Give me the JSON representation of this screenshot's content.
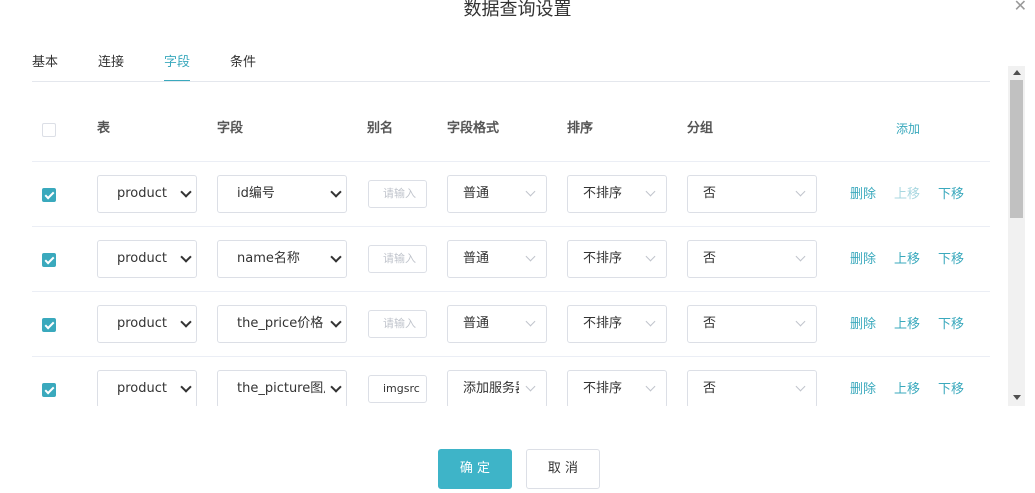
{
  "dialog": {
    "title": "数据查询设置",
    "close_icon": "close-icon"
  },
  "tabs": [
    {
      "label": "基本",
      "active": false
    },
    {
      "label": "连接",
      "active": false
    },
    {
      "label": "字段",
      "active": true
    },
    {
      "label": "条件",
      "active": false
    }
  ],
  "table": {
    "headers": {
      "table": "表",
      "field": "字段",
      "alias": "别名",
      "format": "字段格式",
      "sort": "排序",
      "group": "分组",
      "add": "添加"
    },
    "rows": [
      {
        "checked": true,
        "table": "product",
        "field": "id编号",
        "alias": "",
        "alias_placeholder": "请输入",
        "format": "普通",
        "sort": "不排序",
        "group": "否",
        "delete": "删除",
        "up": "上移",
        "down": "下移",
        "up_enabled": false,
        "down_enabled": true
      },
      {
        "checked": true,
        "table": "product",
        "field": "name名称",
        "alias": "",
        "alias_placeholder": "请输入",
        "format": "普通",
        "sort": "不排序",
        "group": "否",
        "delete": "删除",
        "up": "上移",
        "down": "下移",
        "up_enabled": true,
        "down_enabled": true
      },
      {
        "checked": true,
        "table": "product",
        "field": "the_price价格",
        "alias": "",
        "alias_placeholder": "请输入",
        "format": "普通",
        "sort": "不排序",
        "group": "否",
        "delete": "删除",
        "up": "上移",
        "down": "下移",
        "up_enabled": true,
        "down_enabled": true
      },
      {
        "checked": true,
        "table": "product",
        "field": "the_picture图片",
        "alias": "imgsrc",
        "alias_placeholder": "请输入",
        "format": "添加服务器地址",
        "sort": "不排序",
        "group": "否",
        "delete": "删除",
        "up": "上移",
        "down": "下移",
        "up_enabled": true,
        "down_enabled": true
      }
    ]
  },
  "footer": {
    "confirm": "确 定",
    "cancel": "取 消"
  },
  "colors": {
    "accent": "#3aa9bd",
    "primary_button": "#3eb4c8",
    "disabled_link": "#a8d7e0"
  }
}
